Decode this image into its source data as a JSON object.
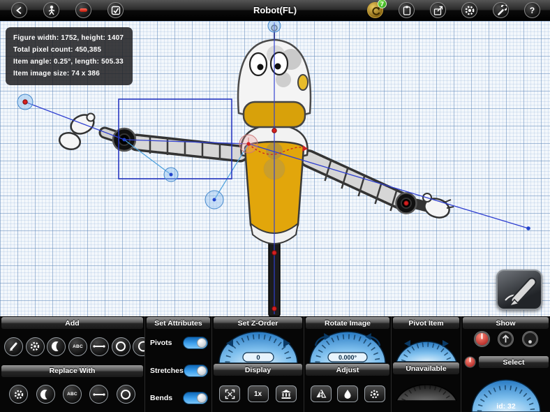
{
  "topbar": {
    "title": "Robot(FL)",
    "undo_badge": "7"
  },
  "info": {
    "lines": [
      "Figure width: 1752, height: 1407",
      "Total pixel count: 450,385",
      "Item angle: 0.25°, length: 505.33",
      "Item image size: 74 x 386"
    ]
  },
  "panel": {
    "add_label": "Add",
    "replace_label": "Replace With",
    "abc_label": "ABC",
    "attributes": {
      "label": "Set Attributes",
      "toggle1": "Pivots",
      "toggle2": "Stretches",
      "toggle3": "Bends"
    },
    "zorder": {
      "label": "Set Z-Order",
      "value": "0",
      "display_label": "Display",
      "scale_label": "1x"
    },
    "rotate": {
      "label": "Rotate Image",
      "value": "0.000°",
      "adjust_label": "Adjust"
    },
    "pivot": {
      "label": "Pivot Item",
      "unavailable_label": "Unavailable"
    },
    "show": {
      "label": "Show",
      "select_label": "Select",
      "id_label": "id: 32"
    }
  },
  "colors": {
    "accent_blue": "#2f7fc6",
    "rig_blue": "#2f3fd0",
    "robot_gold": "#e2a60b",
    "badge_green": "#1f9a10",
    "pivot_red": "#d42020"
  }
}
